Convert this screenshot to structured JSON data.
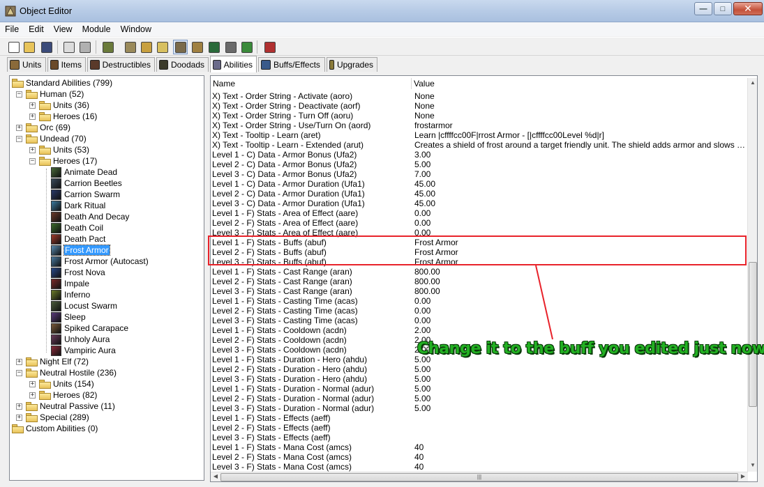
{
  "window": {
    "title": "Object Editor",
    "minimize": "—",
    "maximize": "□",
    "close": "✕"
  },
  "menu": [
    "File",
    "Edit",
    "View",
    "Module",
    "Window"
  ],
  "toolbar_icons": [
    {
      "name": "new-icon",
      "color": "#ffffff",
      "pressed": false
    },
    {
      "name": "open-icon",
      "color": "#e8c45a",
      "pressed": false
    },
    {
      "name": "save-icon",
      "color": "#3b4b7a",
      "pressed": false
    },
    {
      "name": "copy-icon",
      "color": "#dcdcdc",
      "pressed": false
    },
    {
      "name": "paste-icon",
      "color": "#b0b0b0",
      "pressed": false
    },
    {
      "name": "terrain-editor-icon",
      "color": "#6a7a3a",
      "pressed": false
    },
    {
      "name": "trigger-editor-icon",
      "color": "#9a8a5a",
      "pressed": false
    },
    {
      "name": "ai-editor-icon",
      "color": "#c8a040",
      "pressed": false
    },
    {
      "name": "sound-editor-icon",
      "color": "#d8c060",
      "pressed": false
    },
    {
      "name": "object-editor-icon",
      "color": "#7a6a4a",
      "pressed": true
    },
    {
      "name": "campaign-editor-icon",
      "color": "#a08040",
      "pressed": false
    },
    {
      "name": "import-manager-icon",
      "color": "#2a6a3a",
      "pressed": false
    },
    {
      "name": "object-manager-icon",
      "color": "#6a6a6a",
      "pressed": false
    },
    {
      "name": "test-map-icon",
      "color": "#3a8a3a",
      "pressed": false
    },
    {
      "name": "test-map-run-icon",
      "color": "#b03030",
      "pressed": false
    }
  ],
  "tabs": [
    {
      "label": "Units",
      "color": "#8a6a3a",
      "active": false
    },
    {
      "label": "Items",
      "color": "#6a4a2a",
      "active": false
    },
    {
      "label": "Destructibles",
      "color": "#5a3a2a",
      "active": false
    },
    {
      "label": "Doodads",
      "color": "#3a3a2a",
      "active": false
    },
    {
      "label": "Abilities",
      "color": "#6a6a8a",
      "active": true
    },
    {
      "label": "Buffs/Effects",
      "color": "#3a5a8a",
      "active": false
    },
    {
      "label": "Upgrades",
      "color": "#8a7a3a",
      "active": false
    }
  ],
  "tree": [
    {
      "label": "Standard Abilities (799)",
      "kind": "folder",
      "level": 0,
      "exp": ""
    },
    {
      "label": "Human (52)",
      "kind": "folder",
      "level": 1,
      "exp": "−"
    },
    {
      "label": "Units (36)",
      "kind": "folder",
      "level": 2,
      "exp": "+"
    },
    {
      "label": "Heroes (16)",
      "kind": "folder",
      "level": 2,
      "exp": "+"
    },
    {
      "label": "Orc (69)",
      "kind": "folder",
      "level": 1,
      "exp": "+"
    },
    {
      "label": "Undead (70)",
      "kind": "folder",
      "level": 1,
      "exp": "−"
    },
    {
      "label": "Units (53)",
      "kind": "folder",
      "level": 2,
      "exp": "+"
    },
    {
      "label": "Heroes (17)",
      "kind": "folder",
      "level": 2,
      "exp": "−"
    },
    {
      "label": "Animate Dead",
      "kind": "ability",
      "level": 3,
      "color": "#4a6a3a"
    },
    {
      "label": "Carrion Beetles",
      "kind": "ability",
      "level": 3,
      "color": "#3a4a5a"
    },
    {
      "label": "Carrion Swarm",
      "kind": "ability",
      "level": 3,
      "color": "#2a3a6a"
    },
    {
      "label": "Dark Ritual",
      "kind": "ability",
      "level": 3,
      "color": "#3a7aa0"
    },
    {
      "label": "Death And Decay",
      "kind": "ability",
      "level": 3,
      "color": "#6a3a2a"
    },
    {
      "label": "Death Coil",
      "kind": "ability",
      "level": 3,
      "color": "#3a6a2a"
    },
    {
      "label": "Death Pact",
      "kind": "ability",
      "level": 3,
      "color": "#a03a2a"
    },
    {
      "label": "Frost Armor",
      "kind": "ability",
      "level": 3,
      "color": "#5a8ab0",
      "selected": true
    },
    {
      "label": "Frost Armor (Autocast)",
      "kind": "ability",
      "level": 3,
      "color": "#4a7aa0"
    },
    {
      "label": "Frost Nova",
      "kind": "ability",
      "level": 3,
      "color": "#2a4a8a"
    },
    {
      "label": "Impale",
      "kind": "ability",
      "level": 3,
      "color": "#7a2a2a"
    },
    {
      "label": "Inferno",
      "kind": "ability",
      "level": 3,
      "color": "#6a7a2a"
    },
    {
      "label": "Locust Swarm",
      "kind": "ability",
      "level": 3,
      "color": "#4a5a3a"
    },
    {
      "label": "Sleep",
      "kind": "ability",
      "level": 3,
      "color": "#5a3a7a"
    },
    {
      "label": "Spiked Carapace",
      "kind": "ability",
      "level": 3,
      "color": "#7a5a3a"
    },
    {
      "label": "Unholy Aura",
      "kind": "ability",
      "level": 3,
      "color": "#6a3a5a"
    },
    {
      "label": "Vampiric Aura",
      "kind": "ability",
      "level": 3,
      "color": "#8a2a3a"
    },
    {
      "label": "Night Elf (72)",
      "kind": "folder",
      "level": 1,
      "exp": "+"
    },
    {
      "label": "Neutral Hostile (236)",
      "kind": "folder",
      "level": 1,
      "exp": "−"
    },
    {
      "label": "Units (154)",
      "kind": "folder",
      "level": 2,
      "exp": "+"
    },
    {
      "label": "Heroes (82)",
      "kind": "folder",
      "level": 2,
      "exp": "+"
    },
    {
      "label": "Neutral Passive (11)",
      "kind": "folder",
      "level": 1,
      "exp": "+"
    },
    {
      "label": "Special (289)",
      "kind": "folder",
      "level": 1,
      "exp": "+"
    },
    {
      "label": "Custom Abilities (0)",
      "kind": "folder",
      "level": 0,
      "exp": ""
    }
  ],
  "grid": {
    "headers": [
      "Name",
      "Value"
    ],
    "rows": [
      [
        "X) Text - Order String - Activate (aoro)",
        "None"
      ],
      [
        "X) Text - Order String - Deactivate (aorf)",
        "None"
      ],
      [
        "X) Text - Order String - Turn Off (aoru)",
        "None"
      ],
      [
        "X) Text - Order String - Use/Turn On (aord)",
        "frostarmor"
      ],
      [
        "X) Text - Tooltip - Learn (aret)",
        "Learn |cffffcc00F|rrost Armor - [|cffffcc00Level %d|r]"
      ],
      [
        "X) Text - Tooltip - Learn - Extended (arut)",
        "Creates a shield of frost around a target friendly unit. The shield adds armor and slows melee units t..."
      ],
      [
        "Level 1 - C) Data - Armor Bonus (Ufa2)",
        "3.00"
      ],
      [
        "Level 2 - C) Data - Armor Bonus (Ufa2)",
        "5.00"
      ],
      [
        "Level 3 - C) Data - Armor Bonus (Ufa2)",
        "7.00"
      ],
      [
        "Level 1 - C) Data - Armor Duration (Ufa1)",
        "45.00"
      ],
      [
        "Level 2 - C) Data - Armor Duration (Ufa1)",
        "45.00"
      ],
      [
        "Level 3 - C) Data - Armor Duration (Ufa1)",
        "45.00"
      ],
      [
        "Level 1 - F) Stats - Area of Effect (aare)",
        "0.00"
      ],
      [
        "Level 2 - F) Stats - Area of Effect (aare)",
        "0.00"
      ],
      [
        "Level 3 - F) Stats - Area of Effect (aare)",
        "0.00"
      ],
      [
        "Level 1 - F) Stats - Buffs (abuf)",
        "Frost Armor"
      ],
      [
        "Level 2 - F) Stats - Buffs (abuf)",
        "Frost Armor"
      ],
      [
        "Level 3 - F) Stats - Buffs (abuf)",
        "Frost Armor"
      ],
      [
        "Level 1 - F) Stats - Cast Range (aran)",
        "800.00"
      ],
      [
        "Level 2 - F) Stats - Cast Range (aran)",
        "800.00"
      ],
      [
        "Level 3 - F) Stats - Cast Range (aran)",
        "800.00"
      ],
      [
        "Level 1 - F) Stats - Casting Time (acas)",
        "0.00"
      ],
      [
        "Level 2 - F) Stats - Casting Time (acas)",
        "0.00"
      ],
      [
        "Level 3 - F) Stats - Casting Time (acas)",
        "0.00"
      ],
      [
        "Level 1 - F) Stats - Cooldown (acdn)",
        "2.00"
      ],
      [
        "Level 2 - F) Stats - Cooldown (acdn)",
        "2.00"
      ],
      [
        "Level 3 - F) Stats - Cooldown (acdn)",
        "2.00"
      ],
      [
        "Level 1 - F) Stats - Duration - Hero (ahdu)",
        "5.00"
      ],
      [
        "Level 2 - F) Stats - Duration - Hero (ahdu)",
        "5.00"
      ],
      [
        "Level 3 - F) Stats - Duration - Hero (ahdu)",
        "5.00"
      ],
      [
        "Level 1 - F) Stats - Duration - Normal (adur)",
        "5.00"
      ],
      [
        "Level 2 - F) Stats - Duration - Normal (adur)",
        "5.00"
      ],
      [
        "Level 3 - F) Stats - Duration - Normal (adur)",
        "5.00"
      ],
      [
        "Level 1 - F) Stats - Effects (aeff)",
        ""
      ],
      [
        "Level 2 - F) Stats - Effects (aeff)",
        ""
      ],
      [
        "Level 3 - F) Stats - Effects (aeff)",
        ""
      ],
      [
        "Level 1 - F) Stats - Mana Cost (amcs)",
        "40"
      ],
      [
        "Level 2 - F) Stats - Mana Cost (amcs)",
        "40"
      ],
      [
        "Level 3 - F) Stats - Mana Cost (amcs)",
        "40"
      ]
    ]
  },
  "annotation": {
    "callout": "Change it to the buff you edited just now",
    "box_color": "#e8222a",
    "text_color": "#22b022"
  }
}
